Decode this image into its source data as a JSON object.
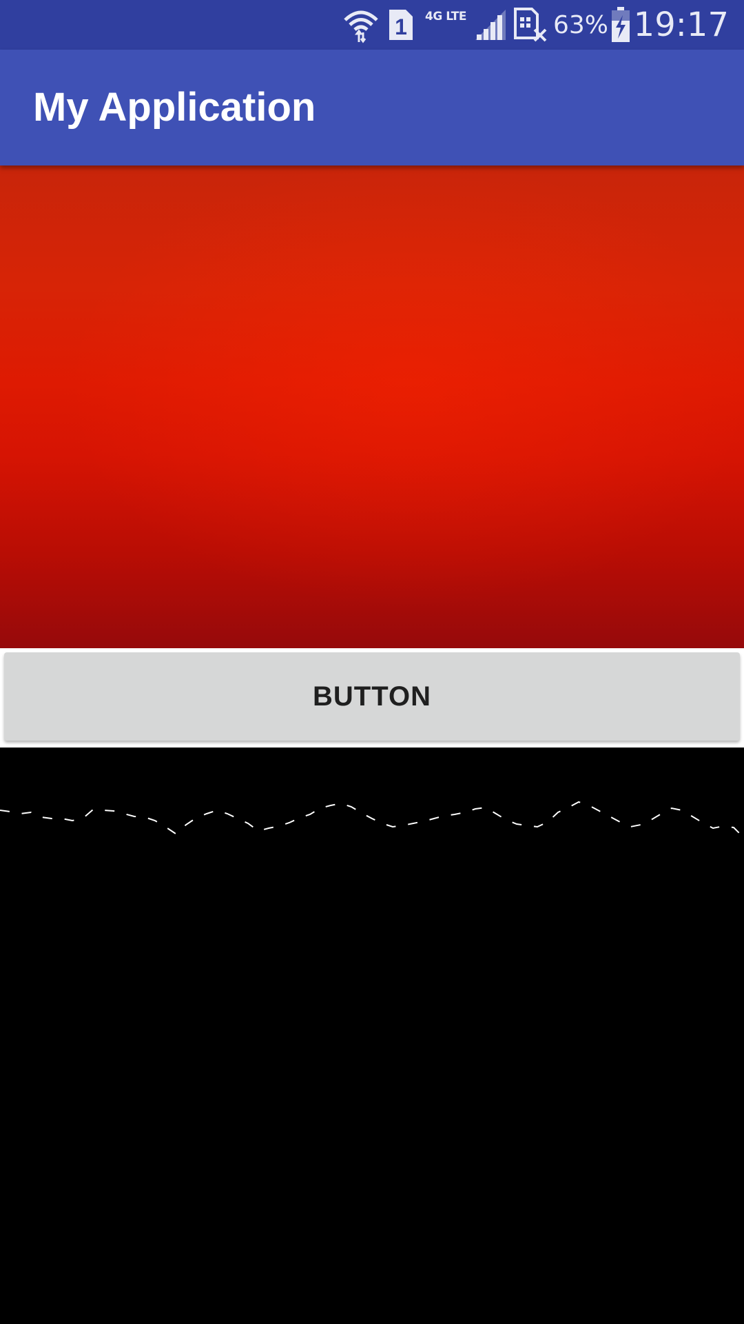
{
  "status_bar": {
    "network_type": "4G LTE",
    "sim_slot": "1",
    "battery_percent": "63%",
    "time": "19:17",
    "icons": [
      "wifi-icon",
      "sim-1-icon",
      "cell-signal-icon",
      "no-sim-icon",
      "battery-charging-icon"
    ],
    "color": "#303F9F"
  },
  "app_bar": {
    "title": "My Application",
    "color": "#3F51B5"
  },
  "image_view": {
    "description_color": "#D71A04"
  },
  "button": {
    "label": "BUTTON",
    "color": "#D6D7D7"
  },
  "canvas": {
    "background": "#000000",
    "stroke_color": "#FFFFFF",
    "line_style": "dashed"
  }
}
